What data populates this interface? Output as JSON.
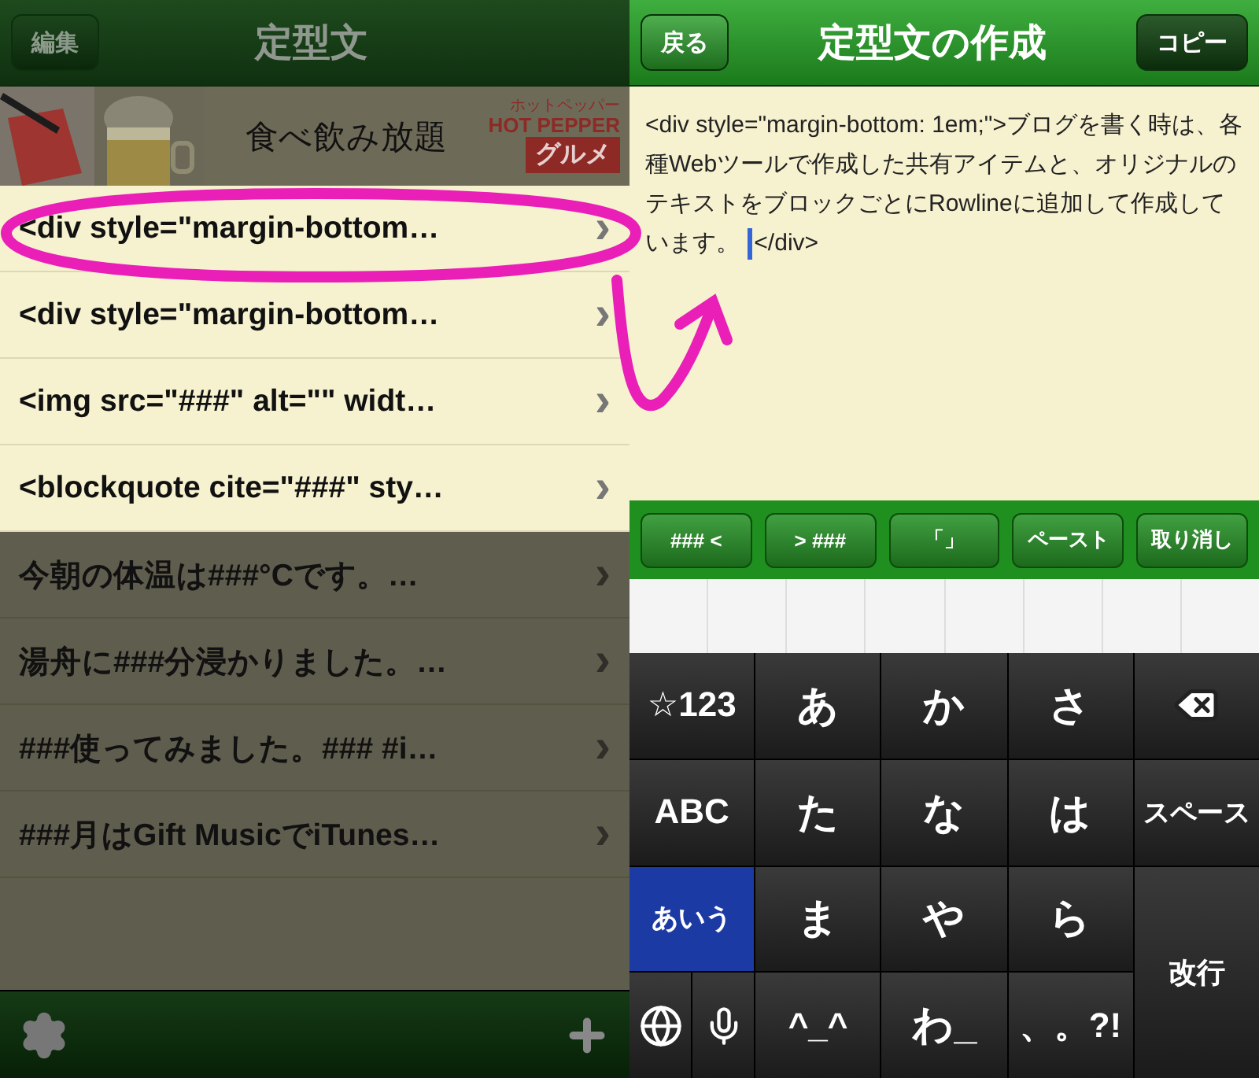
{
  "list_screen": {
    "edit_button": "編集",
    "title": "定型文",
    "ad": {
      "headline": "食べ飲み放題",
      "brand_kana": "ホットペッパー",
      "brand": "HOT PEPPER",
      "brand_sub": "グルメ"
    },
    "rows": [
      {
        "text": "<div style=\"margin-bottom…",
        "dimmed": false
      },
      {
        "text": "<div style=\"margin-bottom…",
        "dimmed": false
      },
      {
        "text": "<img src=\"###\" alt=\"\" widt…",
        "dimmed": false
      },
      {
        "text": "<blockquote cite=\"###\" sty…",
        "dimmed": false
      },
      {
        "text": "今朝の体温は###°Cです。…",
        "dimmed": true
      },
      {
        "text": "湯舟に###分浸かりました。…",
        "dimmed": true
      },
      {
        "text": "###使ってみました。### #i…",
        "dimmed": true
      },
      {
        "text": "###月はGift MusicでiTunes…",
        "dimmed": true
      }
    ],
    "chevron": "›"
  },
  "edit_screen": {
    "back_button": "戻る",
    "title": "定型文の作成",
    "copy_button": "コピー",
    "text": "<div style=\"margin-bottom: 1em;\">ブログを書く時は、各種Webツールで作成した共有アイテムと、オリジナルのテキストをブロックごとにRowlineに追加して作成しています。",
    "text_after_cursor": "</div>",
    "toolbar": [
      "### <",
      "> ###",
      "「」",
      "ペースト",
      "取り消し"
    ],
    "keys": [
      {
        "kind": "text",
        "label": "☆123",
        "selected": false
      },
      {
        "kind": "text",
        "label": "あ",
        "selected": false
      },
      {
        "kind": "text",
        "label": "か",
        "selected": false
      },
      {
        "kind": "text",
        "label": "さ",
        "selected": false
      },
      {
        "kind": "delete",
        "selected": false
      },
      {
        "kind": "text",
        "label": "ABC",
        "selected": false
      },
      {
        "kind": "text",
        "label": "た",
        "selected": false
      },
      {
        "kind": "text",
        "label": "な",
        "selected": false
      },
      {
        "kind": "text",
        "label": "は",
        "selected": false
      },
      {
        "kind": "small",
        "label": "スペース",
        "selected": false
      },
      {
        "kind": "small",
        "label": "あいう",
        "selected": true
      },
      {
        "kind": "text",
        "label": "ま",
        "selected": false
      },
      {
        "kind": "text",
        "label": "や",
        "selected": false
      },
      {
        "kind": "text",
        "label": "ら",
        "selected": false
      },
      {
        "kind": "return",
        "label": "改行",
        "selected": false
      },
      {
        "kind": "globe",
        "selected": false
      },
      {
        "kind": "mic",
        "selected": false
      },
      {
        "kind": "text",
        "label": "^_^",
        "selected": false
      },
      {
        "kind": "text",
        "label": "わ_",
        "selected": false
      },
      {
        "kind": "text",
        "label": "、。?!",
        "selected": false
      }
    ]
  }
}
